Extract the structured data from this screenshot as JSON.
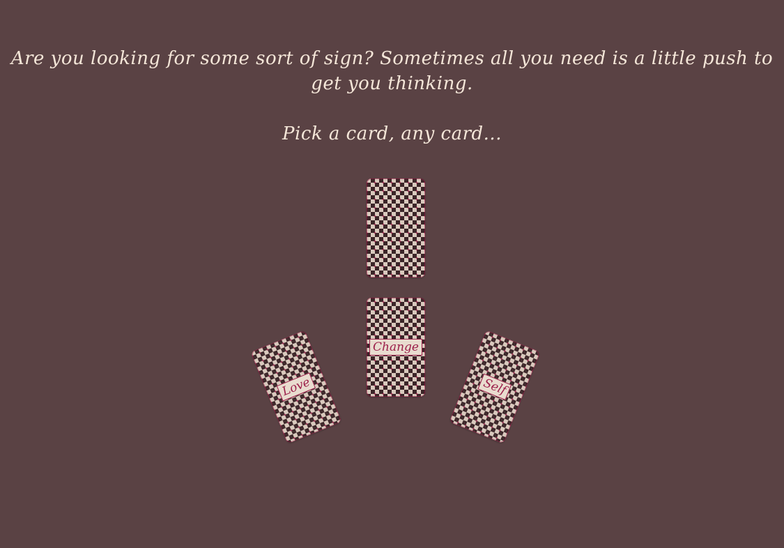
{
  "intro": {
    "line1": "Are you looking for some sort of sign? Sometimes all you need is a little push to",
    "line2": "get you thinking."
  },
  "prompt": "Pick a card, any card...",
  "cards": [
    {
      "id": "face-down-card",
      "label": ""
    },
    {
      "id": "change-card",
      "label": "Change"
    },
    {
      "id": "love-card",
      "label": "Love"
    },
    {
      "id": "self-card",
      "label": "Self"
    }
  ],
  "colors": {
    "background": "#5a4244",
    "text": "#f4e6d8",
    "card_accent": "#9c1f4a",
    "card_dark": "#3b2528",
    "card_light": "#d9c9bd"
  }
}
